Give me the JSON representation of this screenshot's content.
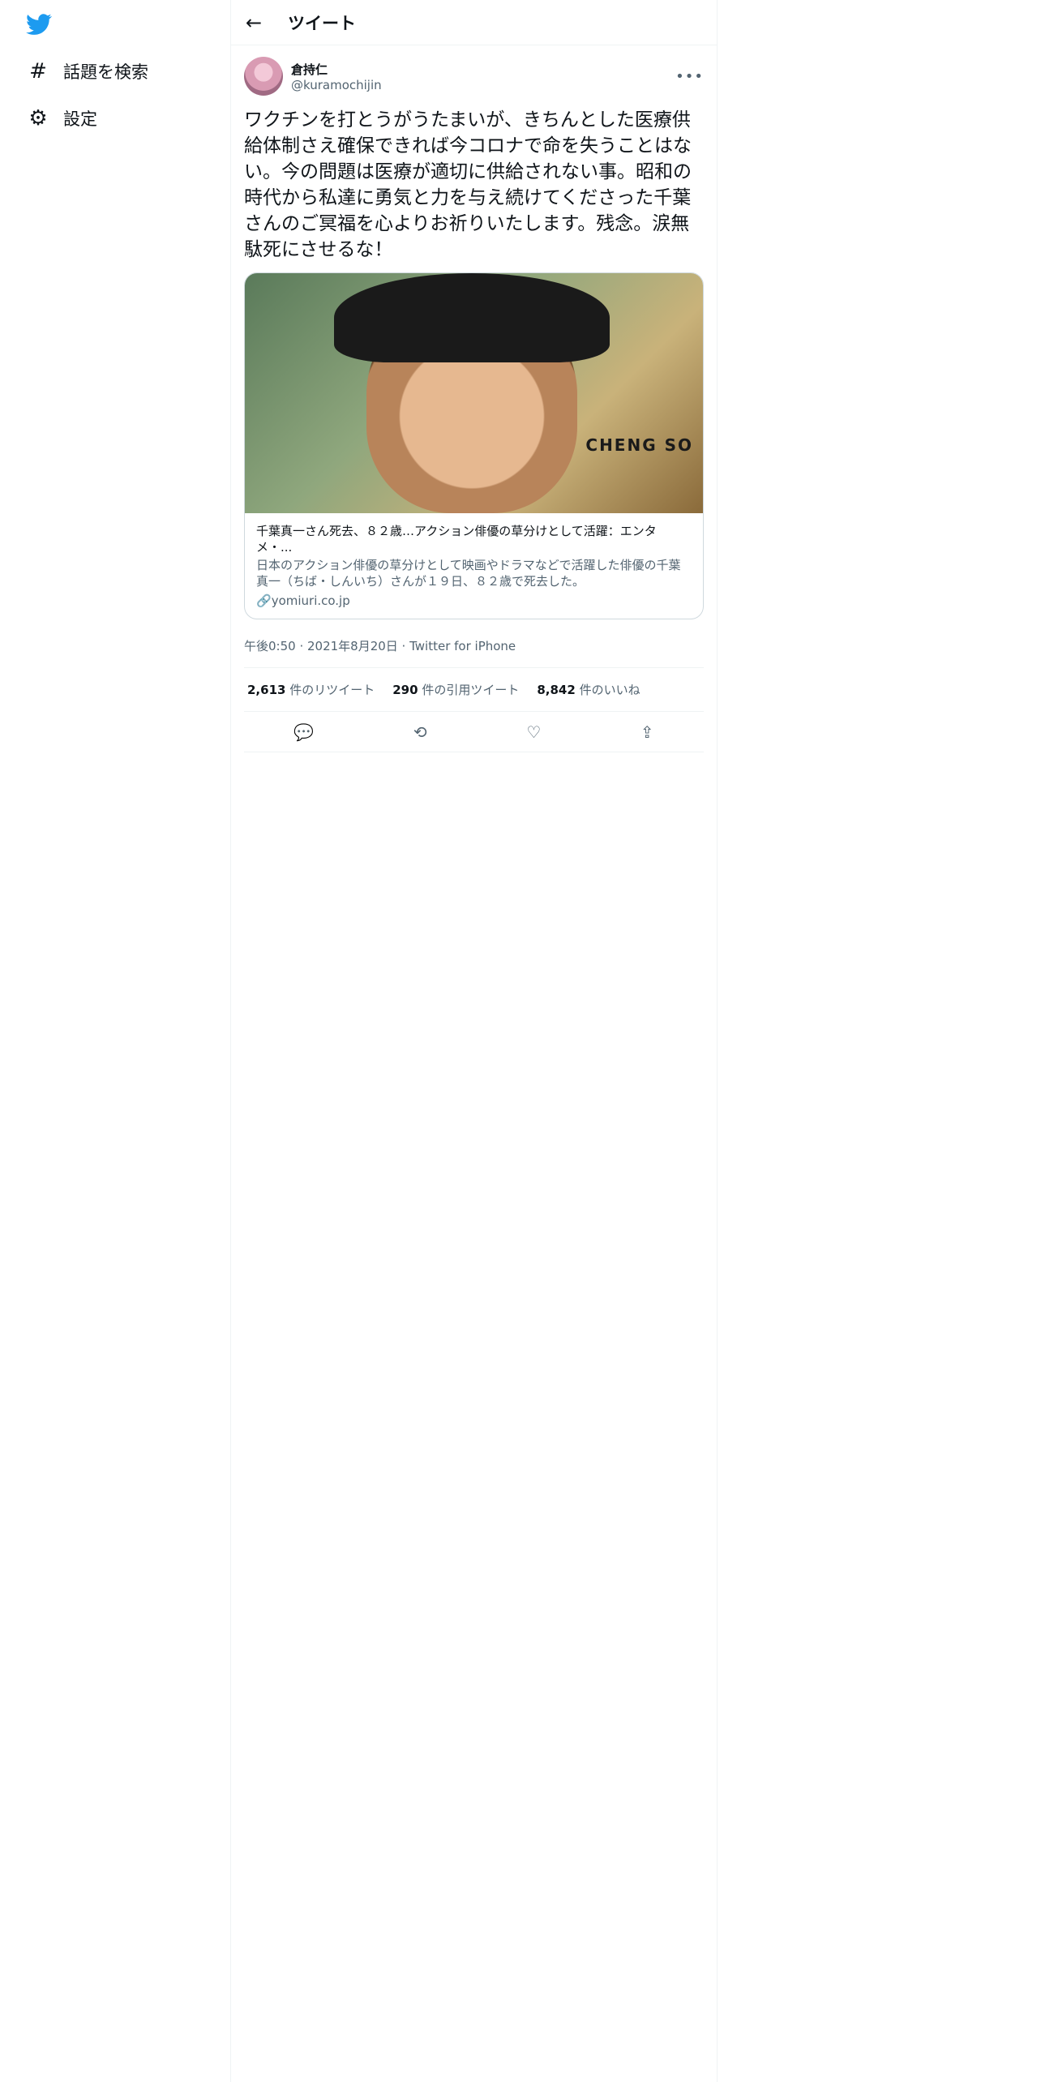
{
  "nav": {
    "explore": "話題を検索",
    "settings": "設定"
  },
  "header": {
    "title": "ツイート"
  },
  "tweet": {
    "name": "倉持仁",
    "handle": "@kuramochijin",
    "text": "ワクチンを打とうがうたまいが、きちんとした医療供給体制さえ確保できれば今コロナで命を失うことはない。今の問題は医療が適切に供給されない事。昭和の時代から私達に勇気と力を与え続けてくださった千葉さんのご冥福を心よりお祈りいたします。残念。涙無駄死にさせるな！",
    "card": {
      "title": "千葉真一さん死去、８２歳…アクション俳優の草分けとして活躍：エンタメ・...",
      "desc": "日本のアクション俳優の草分けとして映画やドラマなどで活躍した俳優の千葉真一（ちば・しんいち）さんが１９日、８２歳で死去した。",
      "url": "yomiuri.co.jp",
      "brand": "CHENG SO"
    },
    "meta": "午後0:50 · 2021年8月20日 · Twitter for iPhone",
    "retweets": "2,613",
    "retweets_label": "件のリツイート",
    "quotes": "290",
    "quotes_label": "件の引用ツイート",
    "likes": "8,842",
    "likes_label": "件のいいね"
  }
}
